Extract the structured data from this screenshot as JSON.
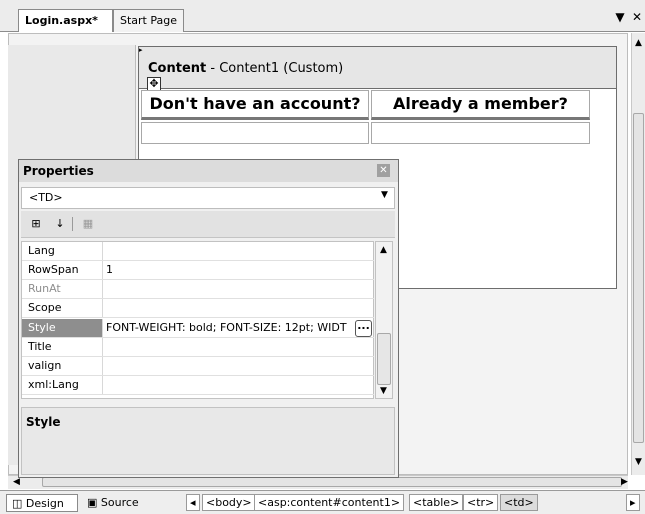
{
  "tabs": [
    {
      "label": "Login.aspx*",
      "active": true
    },
    {
      "label": "Start Page",
      "active": false
    }
  ],
  "window_controls": {
    "dropdown_icon": "▼",
    "close_icon": "✕"
  },
  "content_region": {
    "title_bold": "Content",
    "title_rest": " - Content1 (Custom)",
    "marker_icon": "▸",
    "move_icon": "✥"
  },
  "table": {
    "headers": [
      "Don't have an account?",
      "Already a member?"
    ]
  },
  "properties": {
    "title": "Properties",
    "close_icon": "✕",
    "object": "<TD>",
    "toolbar_icons": [
      "⊞",
      "↓",
      "▦"
    ],
    "rows": [
      {
        "name": "Lang",
        "value": ""
      },
      {
        "name": "RowSpan",
        "value": "1"
      },
      {
        "name": "RunAt",
        "value": ""
      },
      {
        "name": "Scope",
        "value": ""
      },
      {
        "name": "Style",
        "value": "FONT-WEIGHT: bold; FONT-SIZE: 12pt; WIDT"
      },
      {
        "name": "Title",
        "value": ""
      },
      {
        "name": "valign",
        "value": ""
      },
      {
        "name": "xml:Lang",
        "value": ""
      }
    ],
    "ellipsis_label": "...",
    "description_title": "Style"
  },
  "bottom": {
    "design_label": "Design",
    "source_label": "Source",
    "breadcrumbs": [
      "<body>",
      "<asp:content#content1>",
      "<table>",
      "<tr>",
      "<td>"
    ]
  },
  "colors": {
    "selected_row": "#8e8e8e",
    "panel_bg": "#f0f0f0"
  }
}
